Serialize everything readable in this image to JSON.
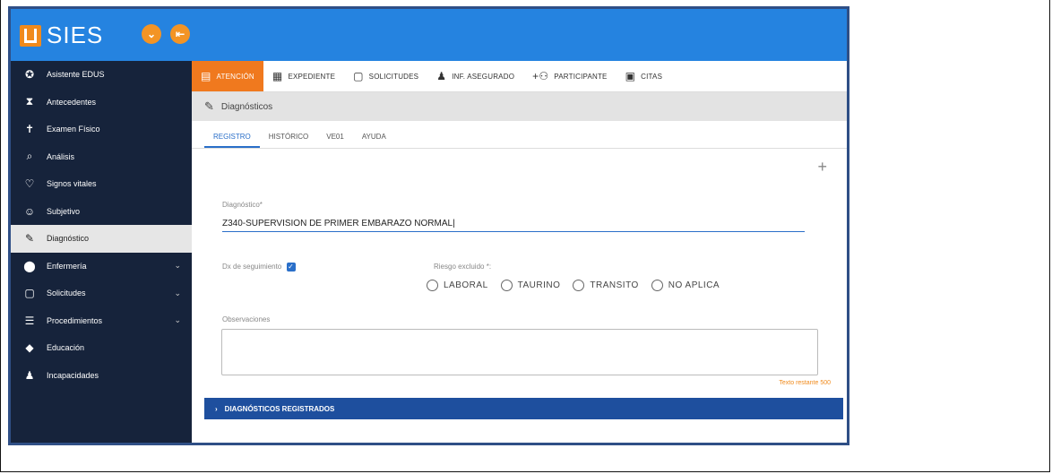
{
  "app": {
    "title": "SIES"
  },
  "sidebar": {
    "items": [
      {
        "label": "Asistente EDUS",
        "icon": "settings-gear-icon",
        "glyph": "✪",
        "expandable": false
      },
      {
        "label": "Antecedentes",
        "icon": "hourglass-icon",
        "glyph": "⧗",
        "expandable": false
      },
      {
        "label": "Examen Físico",
        "icon": "person-icon",
        "glyph": "✝",
        "expandable": false
      },
      {
        "label": "Análisis",
        "icon": "search-analysis-icon",
        "glyph": "⌕",
        "expandable": false
      },
      {
        "label": "Signos vitales",
        "icon": "heart-icon",
        "glyph": "♡",
        "expandable": false
      },
      {
        "label": "Subjetivo",
        "icon": "face-icon",
        "glyph": "☺",
        "expandable": false
      },
      {
        "label": "Diagnóstico",
        "icon": "pencil-icon",
        "glyph": "✎",
        "expandable": false,
        "active": true
      },
      {
        "label": "Enfermería",
        "icon": "location-pin-icon",
        "glyph": "⬤",
        "expandable": true
      },
      {
        "label": "Solicitudes",
        "icon": "monitor-icon",
        "glyph": "▢",
        "expandable": true
      },
      {
        "label": "Procedimientos",
        "icon": "list-icon",
        "glyph": "☰",
        "expandable": true
      },
      {
        "label": "Educación",
        "icon": "graduation-cap-icon",
        "glyph": "◆",
        "expandable": false
      },
      {
        "label": "Incapacidades",
        "icon": "user-icon",
        "glyph": "♟",
        "expandable": false
      }
    ]
  },
  "top_tabs": [
    {
      "label": "ATENCIÓN",
      "icon": "document-icon",
      "glyph": "▤",
      "active": true
    },
    {
      "label": "EXPEDIENTE",
      "icon": "folder-icon",
      "glyph": "▦",
      "active": false
    },
    {
      "label": "SOLICITUDES",
      "icon": "monitor-icon",
      "glyph": "▢",
      "active": false
    },
    {
      "label": "INF. ASEGURADO",
      "icon": "person-icon",
      "glyph": "♟",
      "active": false
    },
    {
      "label": "PARTICIPANTE",
      "icon": "add-group-icon",
      "glyph": "+⚇",
      "active": false
    },
    {
      "label": "CITAS",
      "icon": "calendar-icon",
      "glyph": "▣",
      "active": false
    }
  ],
  "section": {
    "title": "Diagnósticos"
  },
  "sub_tabs": [
    {
      "label": "REGISTRO",
      "active": true
    },
    {
      "label": "HISTÓRICO",
      "active": false
    },
    {
      "label": "VE01",
      "active": false
    },
    {
      "label": "AYUDA",
      "active": false
    }
  ],
  "form": {
    "diagnostico_label": "Diagnóstico*",
    "diagnostico_value": "Z340-SUPERVISION DE PRIMER EMBARAZO NORMAL|",
    "seguimiento_label": "Dx de seguimiento",
    "seguimiento_checked": true,
    "riesgo_label": "Riesgo excluido *:",
    "riesgo_options": [
      "LABORAL",
      "TAURINO",
      "TRANSITO",
      "NO APLICA"
    ],
    "observaciones_label": "Observaciones",
    "observaciones_value": "",
    "remaining_text": "Texto restante 500"
  },
  "registered": {
    "label": "DIAGNÓSTICOS REGISTRADOS"
  },
  "colors": {
    "topbar": "#2583e0",
    "sidebar": "#16233b",
    "accent_orange": "#f0791e",
    "link_blue": "#2a6fc9",
    "registered_bar": "#1e4f9e"
  }
}
